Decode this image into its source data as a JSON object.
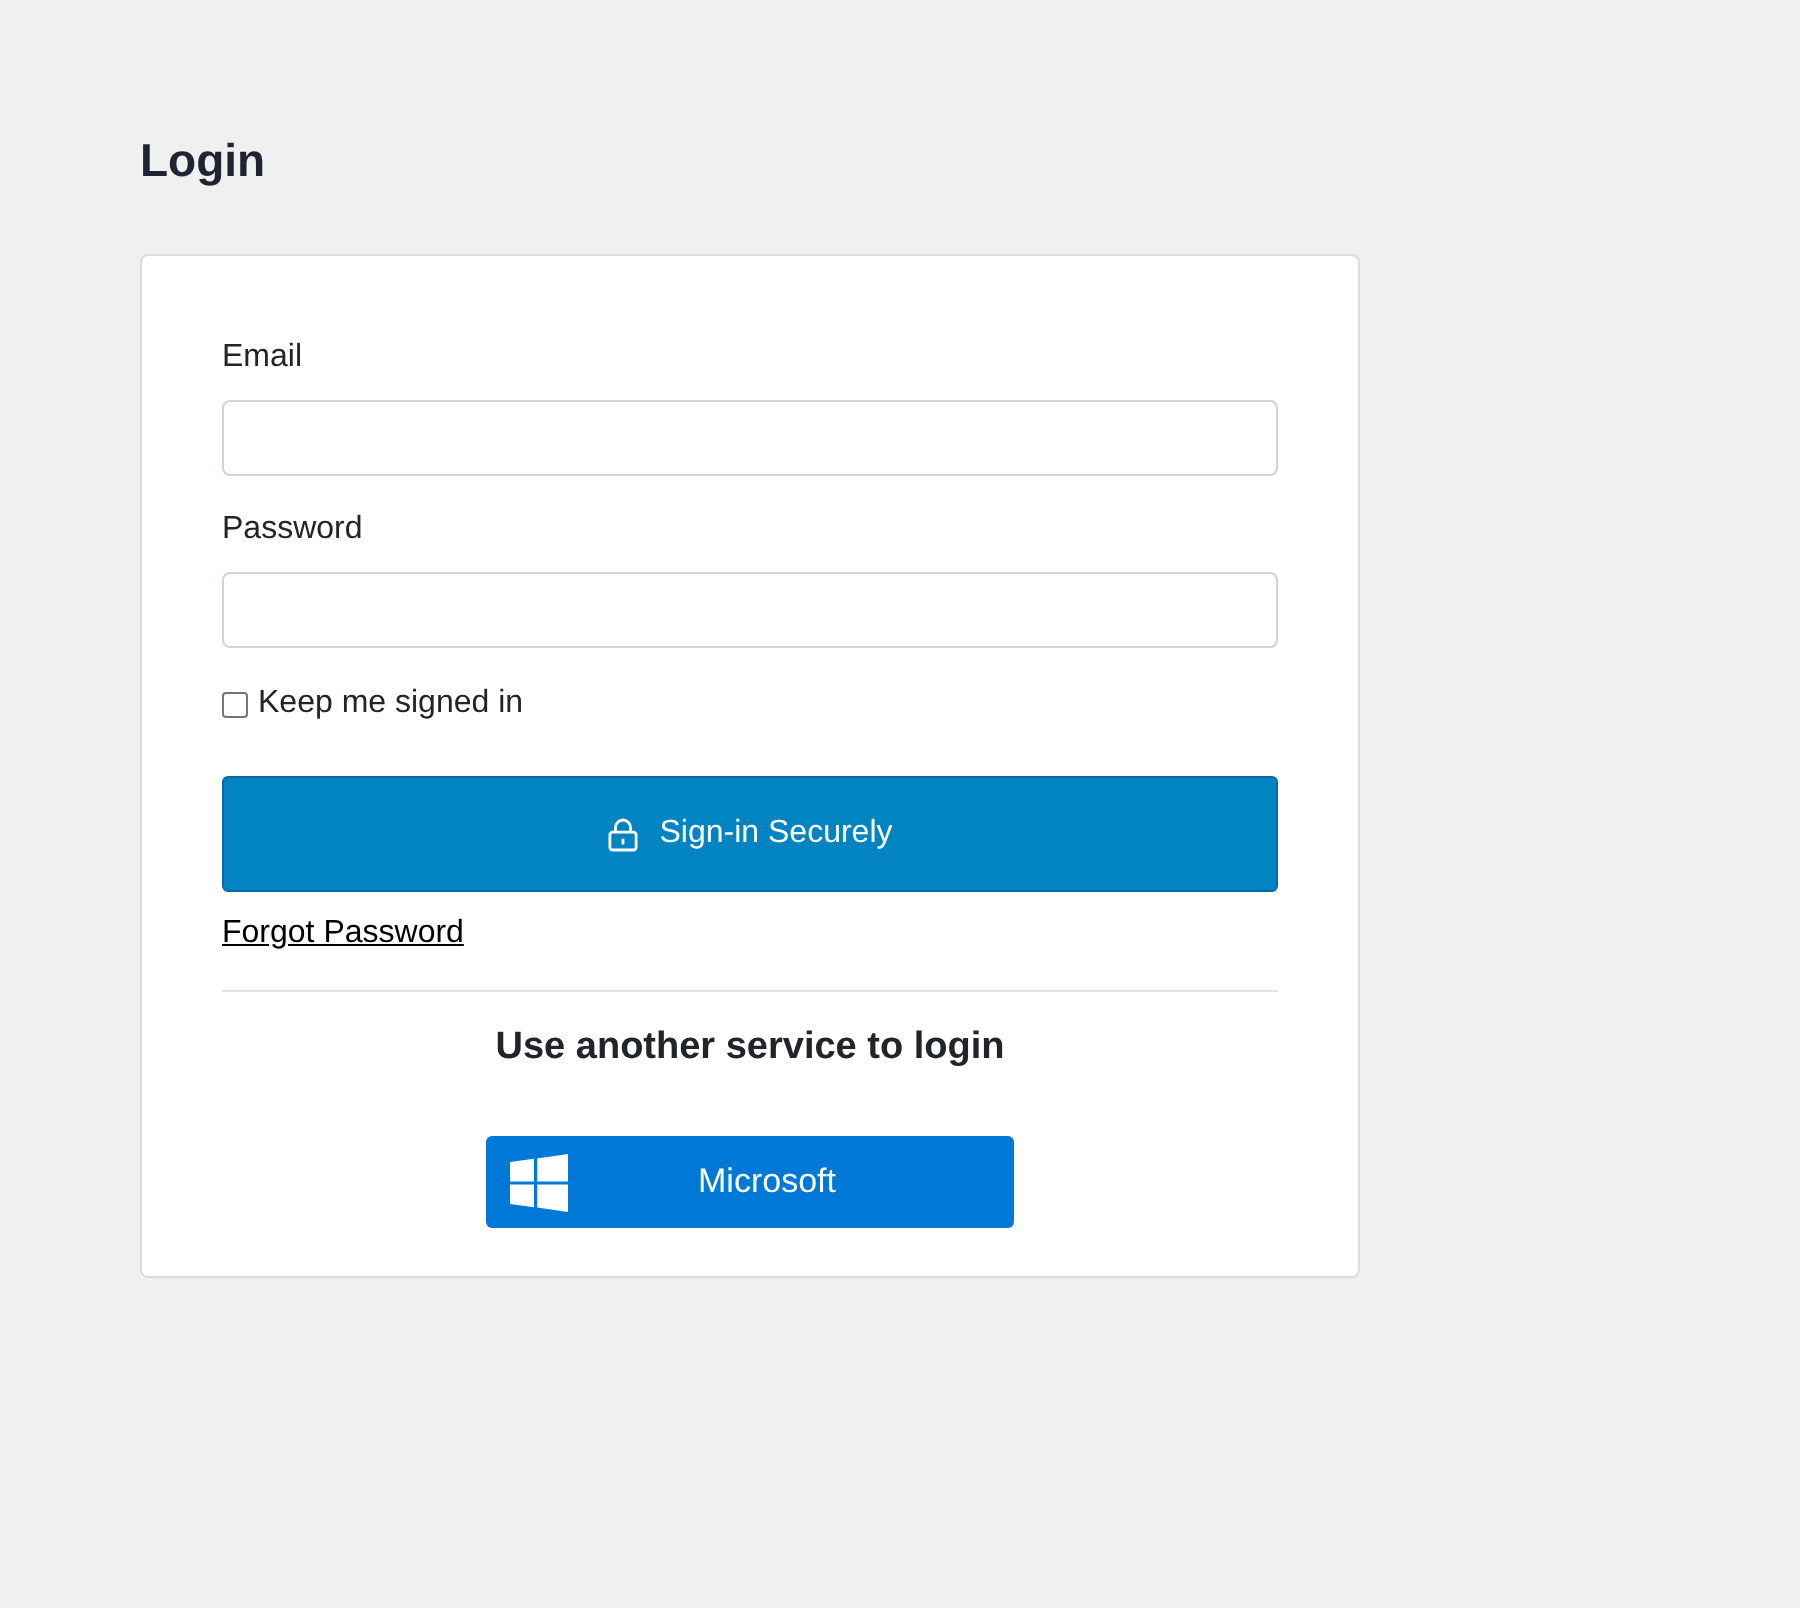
{
  "page": {
    "title": "Login"
  },
  "form": {
    "fields": [
      {
        "label": "Email"
      },
      {
        "label": "Password"
      }
    ],
    "remember": {
      "label": "Keep me signed in",
      "checked": false
    },
    "submit": {
      "label": "Sign-in Securely"
    },
    "forgot_link": "Forgot Password",
    "external": {
      "heading": "Use another service to login",
      "providers": [
        {
          "label": "Microsoft",
          "kind": "microsoft"
        }
      ]
    }
  }
}
